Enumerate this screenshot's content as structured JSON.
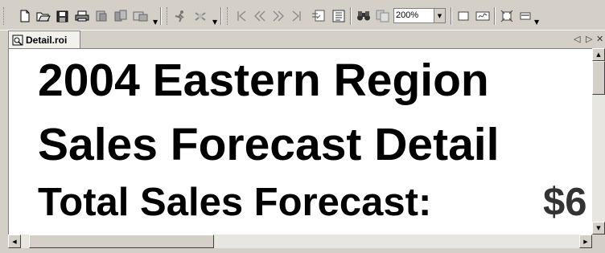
{
  "toolbar": {
    "zoom": "200%",
    "icons": [
      "new-icon",
      "open-icon",
      "save-icon",
      "print-icon",
      "export-icon",
      "properties-icon",
      "page-setup-icon",
      "run-icon",
      "stop-icon",
      "first-page-icon",
      "previous-page-icon",
      "next-page-icon",
      "last-page-icon",
      "go-to-page-icon",
      "toc-icon",
      "find-icon",
      "copy-icon",
      "single-page-icon",
      "multi-page-icon",
      "fit-icon",
      "layout-icon"
    ]
  },
  "tab": {
    "label": "Detail.roi"
  },
  "report": {
    "line1": "2004 Eastern Region",
    "line2": "Sales Forecast Detail",
    "line3_label": "Total Sales Forecast:",
    "line3_amount": "$6"
  },
  "tab_controls": {
    "prev": "◁",
    "next": "▷",
    "close": "✕"
  }
}
